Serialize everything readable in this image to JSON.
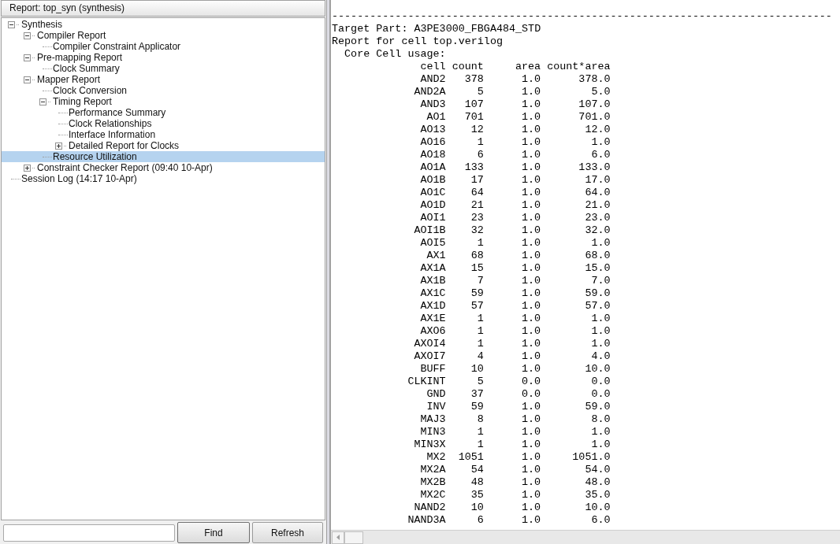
{
  "left_panel": {
    "title": "Report: top_syn (synthesis)",
    "tree": [
      {
        "label": "Synthesis",
        "expanded": true,
        "selected": false,
        "children": [
          {
            "label": "Compiler Report",
            "expanded": true,
            "selected": false,
            "children": [
              {
                "label": "Compiler Constraint Applicator",
                "selected": false
              }
            ]
          },
          {
            "label": "Pre-mapping Report",
            "expanded": true,
            "selected": false,
            "children": [
              {
                "label": "Clock Summary",
                "selected": false
              }
            ]
          },
          {
            "label": "Mapper Report",
            "expanded": true,
            "selected": false,
            "children": [
              {
                "label": "Clock Conversion",
                "selected": false
              },
              {
                "label": "Timing Report",
                "expanded": true,
                "selected": false,
                "children": [
                  {
                    "label": "Performance Summary",
                    "selected": false
                  },
                  {
                    "label": "Clock Relationships",
                    "selected": false
                  },
                  {
                    "label": "Interface Information",
                    "selected": false
                  },
                  {
                    "label": "Detailed Report for Clocks",
                    "expanded": false,
                    "selected": false
                  }
                ]
              },
              {
                "label": "Resource Utilization",
                "selected": true
              }
            ]
          },
          {
            "label": "Constraint Checker Report (09:40 10-Apr)",
            "expanded": false,
            "selected": false
          }
        ]
      },
      {
        "label": "Session Log (14:17 10-Apr)",
        "selected": false
      }
    ],
    "buttons": [
      "Find",
      "Refresh"
    ]
  },
  "report": {
    "lines": [
      "-------------------------------------------------------------------------------",
      "Target Part: A3PE3000_FBGA484_STD",
      "Report for cell top.verilog",
      "  Core Cell usage:"
    ],
    "columns": [
      "cell",
      "count",
      "area",
      "count*area"
    ],
    "rows": [
      [
        "AND2",
        "378",
        "1.0",
        "378.0"
      ],
      [
        "AND2A",
        "5",
        "1.0",
        "5.0"
      ],
      [
        "AND3",
        "107",
        "1.0",
        "107.0"
      ],
      [
        "AO1",
        "701",
        "1.0",
        "701.0"
      ],
      [
        "AO13",
        "12",
        "1.0",
        "12.0"
      ],
      [
        "AO16",
        "1",
        "1.0",
        "1.0"
      ],
      [
        "AO18",
        "6",
        "1.0",
        "6.0"
      ],
      [
        "AO1A",
        "133",
        "1.0",
        "133.0"
      ],
      [
        "AO1B",
        "17",
        "1.0",
        "17.0"
      ],
      [
        "AO1C",
        "64",
        "1.0",
        "64.0"
      ],
      [
        "AO1D",
        "21",
        "1.0",
        "21.0"
      ],
      [
        "AOI1",
        "23",
        "1.0",
        "23.0"
      ],
      [
        "AOI1B",
        "32",
        "1.0",
        "32.0"
      ],
      [
        "AOI5",
        "1",
        "1.0",
        "1.0"
      ],
      [
        "AX1",
        "68",
        "1.0",
        "68.0"
      ],
      [
        "AX1A",
        "15",
        "1.0",
        "15.0"
      ],
      [
        "AX1B",
        "7",
        "1.0",
        "7.0"
      ],
      [
        "AX1C",
        "59",
        "1.0",
        "59.0"
      ],
      [
        "AX1D",
        "57",
        "1.0",
        "57.0"
      ],
      [
        "AX1E",
        "1",
        "1.0",
        "1.0"
      ],
      [
        "AXO6",
        "1",
        "1.0",
        "1.0"
      ],
      [
        "AXOI4",
        "1",
        "1.0",
        "1.0"
      ],
      [
        "AXOI7",
        "4",
        "1.0",
        "4.0"
      ],
      [
        "BUFF",
        "10",
        "1.0",
        "10.0"
      ],
      [
        "CLKINT",
        "5",
        "0.0",
        "0.0"
      ],
      [
        "GND",
        "37",
        "0.0",
        "0.0"
      ],
      [
        "INV",
        "59",
        "1.0",
        "59.0"
      ],
      [
        "MAJ3",
        "8",
        "1.0",
        "8.0"
      ],
      [
        "MIN3",
        "1",
        "1.0",
        "1.0"
      ],
      [
        "MIN3X",
        "1",
        "1.0",
        "1.0"
      ],
      [
        "MX2",
        "1051",
        "1.0",
        "1051.0"
      ],
      [
        "MX2A",
        "54",
        "1.0",
        "54.0"
      ],
      [
        "MX2B",
        "48",
        "1.0",
        "48.0"
      ],
      [
        "MX2C",
        "35",
        "1.0",
        "35.0"
      ],
      [
        "NAND2",
        "10",
        "1.0",
        "10.0"
      ],
      [
        "NAND3A",
        "6",
        "1.0",
        "6.0"
      ]
    ]
  }
}
